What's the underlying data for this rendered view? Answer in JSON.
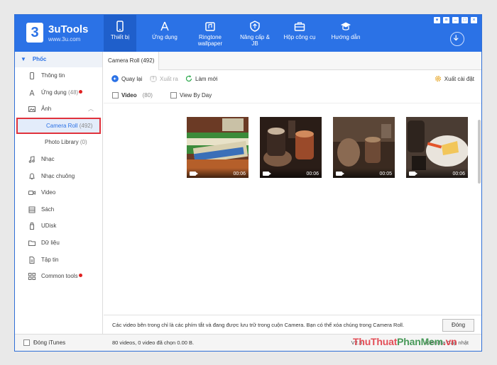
{
  "app": {
    "name": "3uTools",
    "url": "www.3u.com",
    "logo_char": "3"
  },
  "colors": {
    "brand": "#2b72e6",
    "brand_dark": "#1f5fcb",
    "highlight": "#e0323c",
    "badge": "#e02020"
  },
  "nav": [
    {
      "label": "Thiết bị",
      "icon": "phone-icon",
      "active": true
    },
    {
      "label": "Ứng dụng",
      "icon": "appstore-icon"
    },
    {
      "label": "Ringtone wallpaper",
      "icon": "ringtone-icon"
    },
    {
      "label": "Nâng cấp & JB",
      "icon": "shield-icon"
    },
    {
      "label": "Hộp công cụ",
      "icon": "toolbox-icon"
    },
    {
      "label": "Hướng dẫn",
      "icon": "graduation-cap-icon"
    }
  ],
  "sidebar": {
    "device": "Phốc",
    "items": {
      "info": "Thông tin",
      "apps": "Ứng dụng",
      "apps_count": "(48)",
      "photos": "Ảnh",
      "camera_roll": "Camera Roll",
      "camera_roll_count": "(492)",
      "photo_library": "Photo Library",
      "photo_library_count": "(0)",
      "music": "Nhạc",
      "ringtones": "Nhạc chuông",
      "video": "Video",
      "books": "Sách",
      "udisk": "UDisk",
      "data": "Dữ liệu",
      "files": "Tập tin",
      "common_tools": "Common tools"
    }
  },
  "tab": {
    "label": "Camera Roll (492)"
  },
  "toolbar": {
    "back": "Quay lại",
    "export": "Xuất ra",
    "refresh": "Làm mới",
    "export_settings": "Xuất cài đặt"
  },
  "filters": {
    "video": "Video",
    "video_count": "(80)",
    "by_day": "View By Day"
  },
  "thumbnails": [
    {
      "duration": "00:06",
      "icon": "video-camera-icon"
    },
    {
      "duration": "00:06",
      "icon": "video-camera-icon"
    },
    {
      "duration": "00:05",
      "icon": "video-camera-icon"
    },
    {
      "duration": "00:06",
      "icon": "video-camera-icon"
    }
  ],
  "info": {
    "text": "Các video bên trong chỉ là các phím tắt và đang được lưu trữ trong cuộn Camera. Bạn có thể xóa chúng trong Camera Roll.",
    "close": "Đóng"
  },
  "status": {
    "close_itunes": "Đóng iTunes",
    "summary": "80 videos, 0 video đã chọn 0.00 B.",
    "version": "V2.3",
    "update": "Kiểm tra Cập nhật"
  },
  "watermark": {
    "part1": "ThuThuat",
    "part2": "PhanMem",
    "part3": ".vn"
  }
}
